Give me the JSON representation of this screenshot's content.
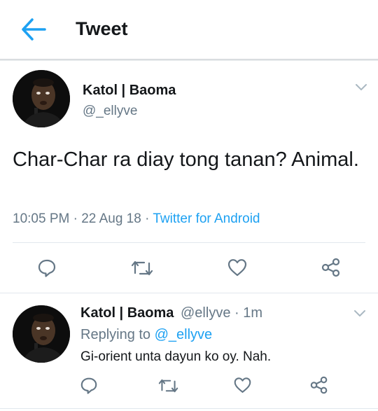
{
  "header": {
    "back_icon": "back-arrow-icon",
    "title": "Tweet",
    "accent_color": "#1da1f2"
  },
  "tweet": {
    "author_name": "Katol | Baoma",
    "author_handle": "@_ellyve",
    "text": "Char-Char ra diay tong tanan? Animal.",
    "time": "10:05 PM",
    "separator1": " · ",
    "date": "22 Aug 18",
    "separator2": " · ",
    "source": "Twitter for Android",
    "actions": [
      "reply-icon",
      "retweet-icon",
      "like-icon",
      "share-icon"
    ]
  },
  "reply": {
    "author_name": "Katol | Baoma",
    "author_handle": "@ellyve · 1m",
    "replying_prefix": "Replying to ",
    "replying_to": "@_ellyve",
    "text": "Gi-orient unta dayun ko oy. Nah.",
    "actions": [
      "reply-icon",
      "retweet-icon",
      "like-icon",
      "share-icon"
    ]
  },
  "colors": {
    "text_primary": "#14171a",
    "text_secondary": "#657786",
    "divider": "#e1e8ed",
    "icon_gray": "#657786"
  }
}
